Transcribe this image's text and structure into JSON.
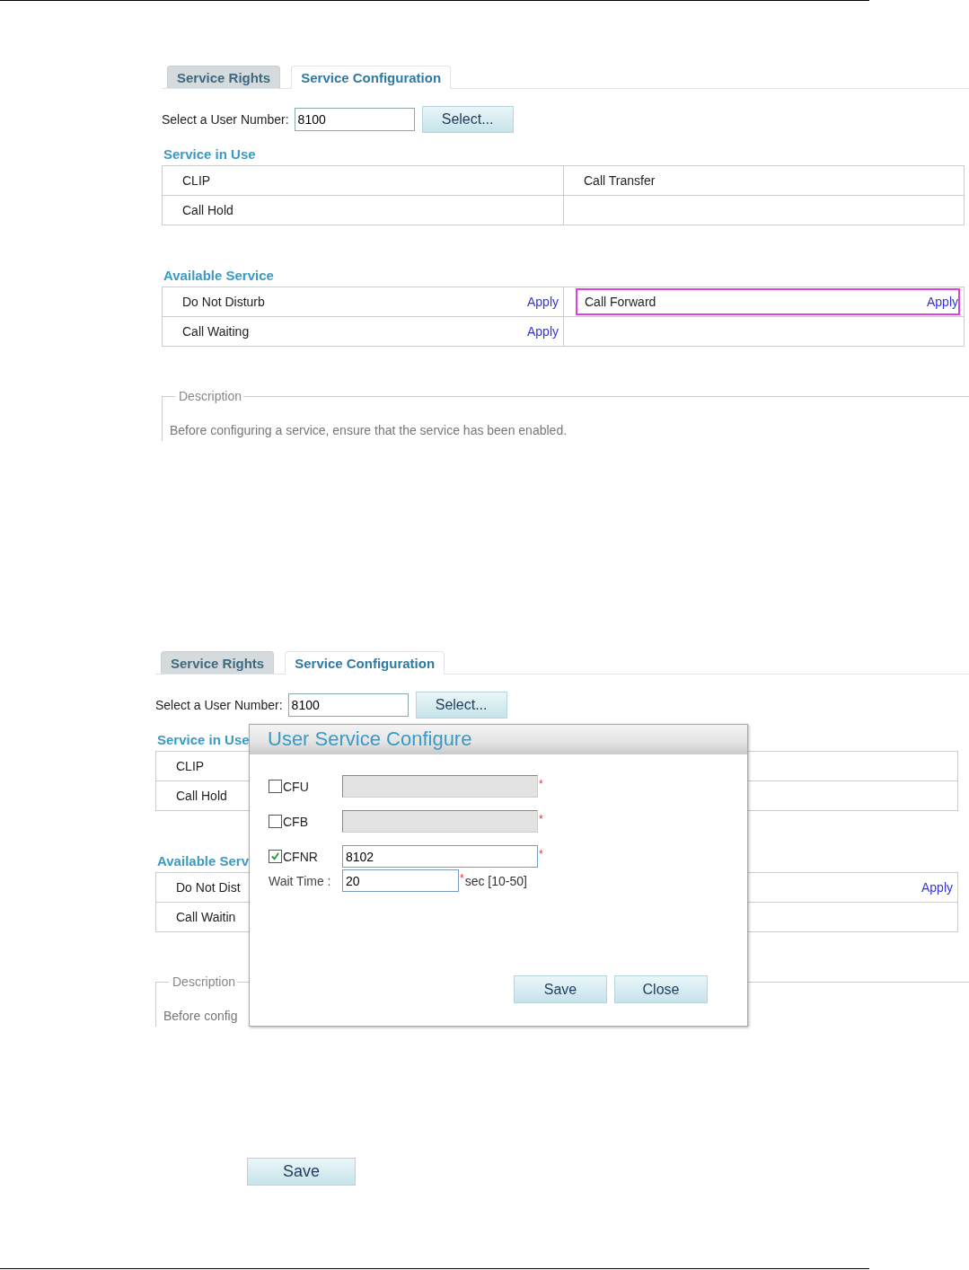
{
  "screens": [
    {
      "tabs": [
        {
          "label": "Service Rights",
          "selected": false
        },
        {
          "label": "Service Configuration",
          "selected": true
        }
      ],
      "user_number": {
        "label": "Select a User Number:",
        "value": "8100",
        "button": "Select..."
      },
      "sections": [
        {
          "title": "Service in Use",
          "rows": [
            {
              "cells": [
                {
                  "label": "CLIP"
                },
                {
                  "label": "Call Transfer"
                }
              ]
            },
            {
              "cells": [
                {
                  "label": "Call Hold"
                }
              ]
            }
          ]
        },
        {
          "title": "Available Service",
          "rows": [
            {
              "cells": [
                {
                  "label": "Do Not Disturb",
                  "action": "Apply"
                },
                {
                  "label": "Call Forward",
                  "action": "Apply",
                  "highlighted": true
                }
              ]
            },
            {
              "cells": [
                {
                  "label": "Call Waiting",
                  "action": "Apply"
                }
              ]
            }
          ]
        }
      ],
      "description": {
        "legend": "Description",
        "text": "Before configuring a service, ensure that the service has been enabled."
      }
    },
    {
      "tabs": [
        {
          "label": "Service Rights",
          "selected": false
        },
        {
          "label": "Service Configuration",
          "selected": true
        }
      ],
      "user_number": {
        "label": "Select a User Number:",
        "value": "8100",
        "button": "Select..."
      },
      "sections": [
        {
          "title": "Service in Use",
          "rows": [
            {
              "cells": [
                {
                  "label": "CLIP"
                }
              ]
            },
            {
              "cells": [
                {
                  "label": "Call Hold"
                }
              ]
            }
          ]
        },
        {
          "title": "Available Serv",
          "rows": [
            {
              "cells": [
                {
                  "label": "Do Not Dist"
                },
                {
                  "action": "Apply"
                }
              ]
            },
            {
              "cells": [
                {
                  "label": "Call Waitin"
                }
              ]
            }
          ]
        }
      ],
      "description": {
        "legend": "Description",
        "text": "Before config"
      },
      "dialog": {
        "title": "User Service Configure",
        "fields": [
          {
            "label": "CFU",
            "checked": false,
            "disabled": true,
            "required_mark": "*"
          },
          {
            "label": "CFB",
            "checked": false,
            "disabled": true,
            "required_mark": "*"
          },
          {
            "label": "CFNR",
            "checked": true,
            "disabled": false,
            "value": "8102",
            "required_mark": "*"
          }
        ],
        "wait_time": {
          "label": "Wait Time :",
          "value": "20",
          "required_mark": "*",
          "hint": "sec [10-50]"
        },
        "buttons": [
          "Save",
          "Close"
        ]
      }
    }
  ],
  "save_button": "Save"
}
